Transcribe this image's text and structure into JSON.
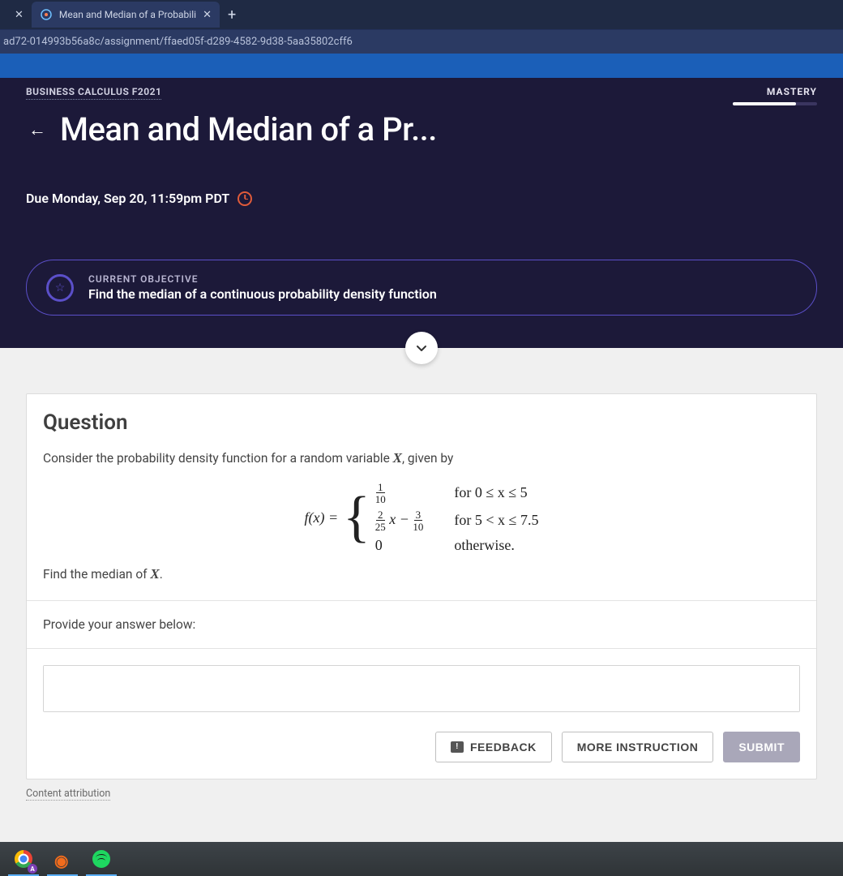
{
  "browser": {
    "tab1_title": "",
    "tab2_title": "Mean and Median of a Probabili",
    "url_fragment": "ad72-014993b56a8c/assignment/ffaed05f-d289-4582-9d38-5aa35802cff6"
  },
  "header": {
    "course": "BUSINESS CALCULUS F2021",
    "mastery_label": "MASTERY",
    "mastery_pct": 75,
    "title": "Mean and Median of a Pr...",
    "due_text": "Due Monday, Sep 20, 11:59pm PDT"
  },
  "objective": {
    "label": "CURRENT OBJECTIVE",
    "title": "Find the median of a continuous probability density function"
  },
  "question": {
    "heading": "Question",
    "intro_pre": "Consider the probability density function for a random variable ",
    "intro_var": "X",
    "intro_post": ", given by",
    "lhs": "f(x) =",
    "row1_expr_num": "1",
    "row1_expr_den": "10",
    "row1_cond": "for 0 ≤ x ≤ 5",
    "row2_a_num": "2",
    "row2_a_den": "25",
    "row2_mid": "x −",
    "row2_b_num": "3",
    "row2_b_den": "10",
    "row2_cond": "for 5 < x ≤ 7.5",
    "row3_expr": "0",
    "row3_cond": "otherwise.",
    "find_pre": "Find the median of ",
    "find_var": "X",
    "find_post": "."
  },
  "answer": {
    "prompt": "Provide your answer below:",
    "value": ""
  },
  "buttons": {
    "feedback": "FEEDBACK",
    "more_instruction": "MORE INSTRUCTION",
    "submit": "SUBMIT"
  },
  "footer": {
    "attribution": "Content attribution"
  },
  "taskbar": {
    "chrome_badge": "A"
  }
}
